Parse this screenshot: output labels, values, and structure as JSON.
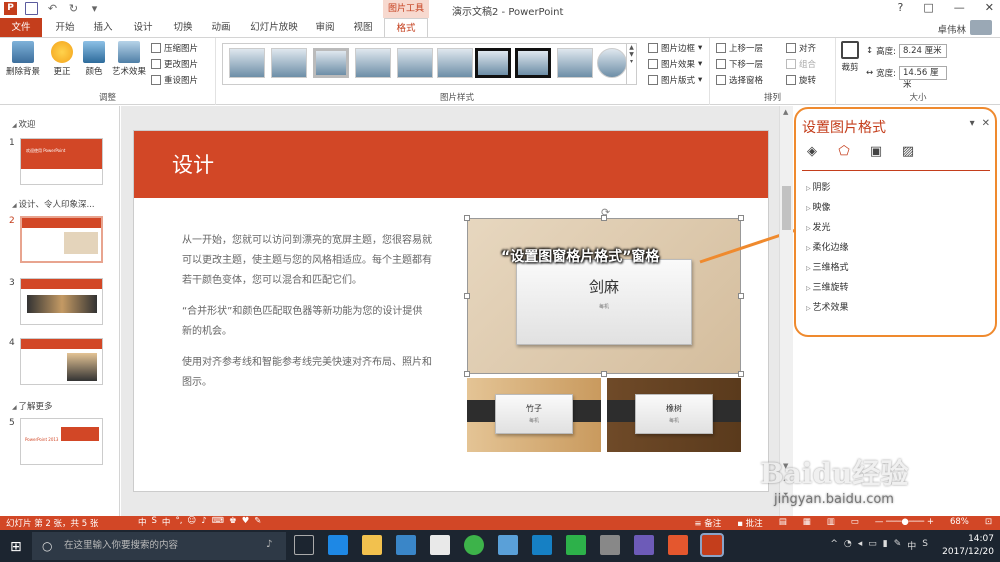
{
  "titlebar": {
    "context_tab_header": "图片工具",
    "doc_title": "演示文稿2 - PowerPoint",
    "minimize": "?",
    "restore": "□",
    "maximize": "—",
    "close": "✕"
  },
  "tabs": [
    "文件",
    "开始",
    "插入",
    "设计",
    "切换",
    "动画",
    "幻灯片放映",
    "审阅",
    "视图",
    "格式"
  ],
  "user_name": "卓伟林",
  "ribbon": {
    "adjust": {
      "remove_bg": "删除背景",
      "correct": "更正",
      "color": "颜色",
      "artistic": "艺术效果",
      "compress": "压缩图片",
      "change": "更改图片",
      "reset": "重设图片",
      "label": "调整"
    },
    "styles": {
      "label": "图片样式",
      "border": "图片边框",
      "effects": "图片效果",
      "layout": "图片版式"
    },
    "arrange": {
      "bring_forward": "上移一层",
      "send_backward": "下移一层",
      "selection_pane": "选择窗格",
      "align": "对齐",
      "group": "组合",
      "rotate": "旋转",
      "label": "排列"
    },
    "size": {
      "crop": "裁剪",
      "height_label": "高度:",
      "height_value": "8.24 厘米",
      "width_label": "宽度:",
      "width_value": "14.56 厘米",
      "label": "大小"
    }
  },
  "thumbnails": {
    "sections": [
      "欢迎",
      "设计、令人印象深...",
      "了解更多"
    ],
    "slide_numbers": [
      "1",
      "2",
      "3",
      "4",
      "5"
    ],
    "thumb1_text": "欢迎使用 PowerPoint",
    "thumb5_text": "PowerPoint 2013"
  },
  "slide": {
    "title": "设计",
    "paragraphs": [
      "从一开始，您就可以访问到漂亮的宽屏主题，您很容易就可以更改主题，使主题与您的风格相适应。每个主题都有若干颜色变体，您可以混合和匹配它们。",
      "“合并形状”和颜色匹配取色器等新功能为您的设计提供新的机会。",
      "使用对齐参考线和智能参考线完美快速对齐布局、照片和图示。"
    ],
    "card_main_title": "剑麻",
    "card_main_sub": "每机",
    "card_bamboo_title": "竹子",
    "card_bamboo_sub": "每机",
    "card_oak_title": "橡树",
    "card_oak_sub": "每机",
    "callout": "“设置图窗格片格式”窗格"
  },
  "format_pane": {
    "title": "设置图片格式",
    "items": [
      "阴影",
      "映像",
      "发光",
      "柔化边缘",
      "三维格式",
      "三维旋转",
      "艺术效果"
    ]
  },
  "statusbar": {
    "slide_info": "幻灯片 第 2 张，共 5 张",
    "ime": [
      "中",
      "S",
      "中",
      "°,",
      "☺",
      "♪",
      "⌨",
      "♚",
      "♥",
      "✎"
    ],
    "notes": "备注",
    "comments": "批注",
    "zoom": "68%"
  },
  "taskbar": {
    "search_placeholder": "在这里输入你要搜索的内容",
    "time": "14:07",
    "date": "2017/12/20",
    "ime_cn": "中"
  },
  "watermark": {
    "brand": "Baidu经验",
    "url": "jingyan.baidu.com"
  },
  "colors": {
    "accent": "#d24726",
    "highlight": "#ef8a2e",
    "taskbar": "#1c2530"
  }
}
